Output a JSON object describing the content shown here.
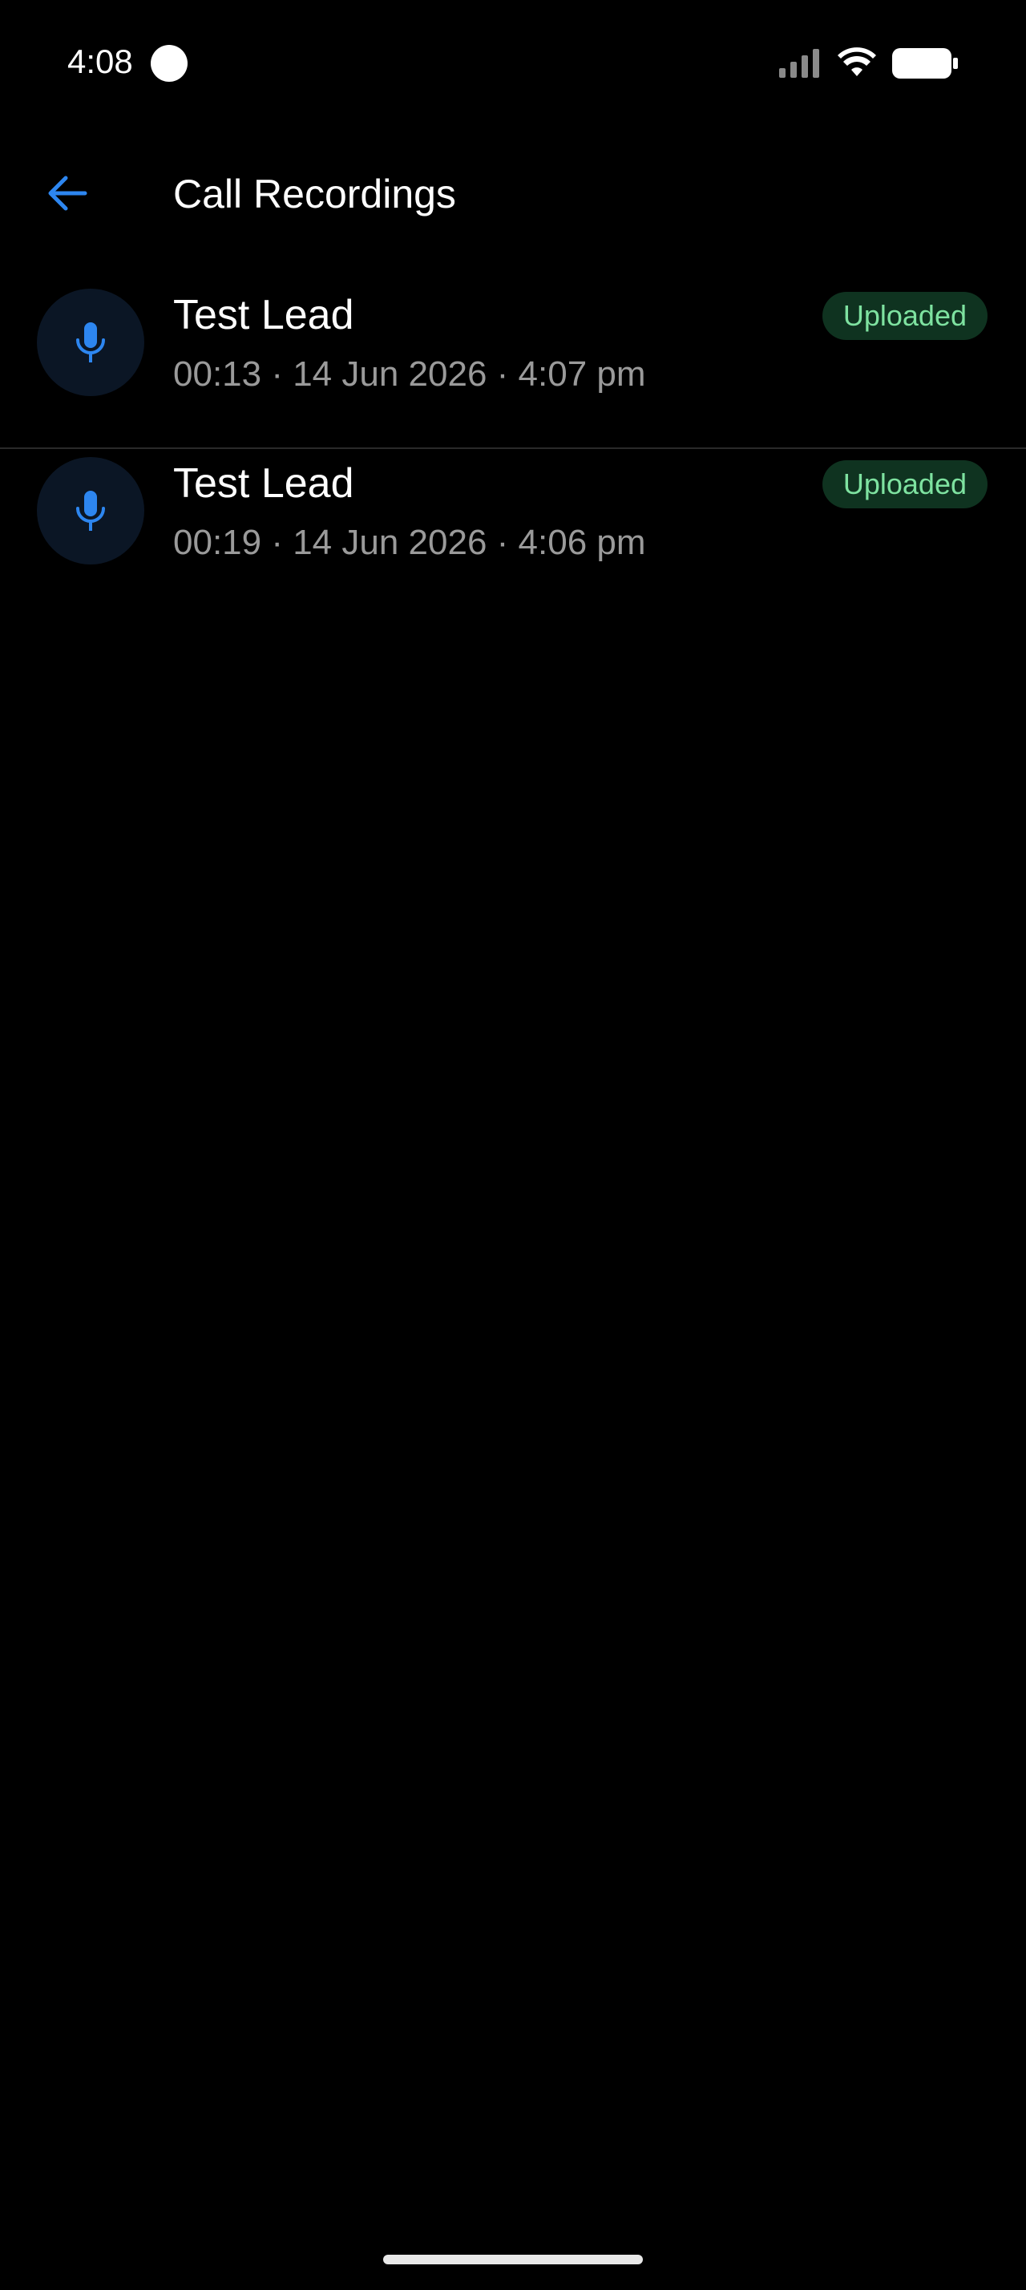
{
  "status_bar": {
    "time": "4:08",
    "icons": [
      "signal-icon",
      "wifi-icon",
      "battery-icon"
    ]
  },
  "app_bar": {
    "title": "Call Recordings",
    "back_icon": "arrow-left-icon"
  },
  "recordings": [
    {
      "title": "Test Lead",
      "meta": "00:13 · 14 Jun 2026 · 4:07 pm",
      "status": "Uploaded",
      "icon": "microphone-icon"
    },
    {
      "title": "Test Lead",
      "meta": "00:19 · 14 Jun 2026 · 4:06 pm",
      "status": "Uploaded",
      "icon": "microphone-icon"
    }
  ],
  "colors": {
    "background": "#000000",
    "accent": "#2d86f0",
    "badge_background": "#0f3320",
    "badge_text": "#7ee2a0",
    "secondary_text": "#9a9a9a",
    "avatar_background": "#0b1625"
  }
}
